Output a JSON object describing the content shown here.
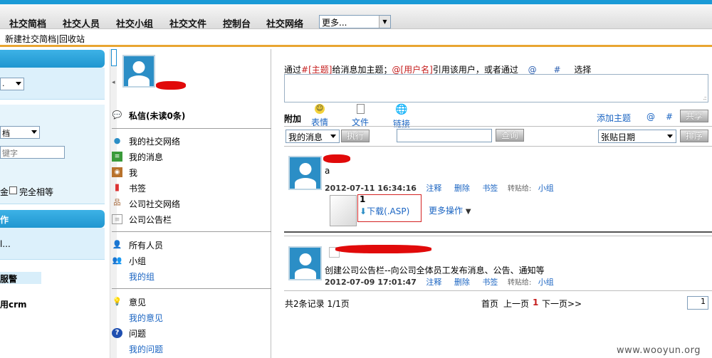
{
  "nav": {
    "items": [
      "社交简档",
      "社交人员",
      "社交小组",
      "社交文件",
      "控制台",
      "社交网络"
    ],
    "more_select": "更多..."
  },
  "subbar": {
    "text": "新建社交简档|回收站"
  },
  "left": {
    "sel1": ".",
    "sel2": "档",
    "keyword_placeholder": "键字",
    "checkbox1_label": "金",
    "checkbox2_label": "完全相等",
    "head2": "作",
    "panel_text": "l...",
    "alarm_label": "服警",
    "crm_text": "用crm"
  },
  "middle": {
    "private_msg": "私信(未读0条)",
    "items_a": [
      {
        "icon": "speech-bubble-icon",
        "label": "我的社交网络"
      },
      {
        "icon": "message-icon",
        "label": "我的消息"
      },
      {
        "icon": "contact-card-icon",
        "label": "我"
      },
      {
        "icon": "bookmark-icon",
        "label": "书签"
      },
      {
        "icon": "org-chart-icon",
        "label": "公司社交网络"
      },
      {
        "icon": "notice-board-icon",
        "label": "公司公告栏"
      }
    ],
    "all_people": "所有人员",
    "groups": "小组",
    "my_groups": "我的组",
    "opinion": "意见",
    "my_opinion": "我的意见",
    "question": "问题",
    "my_question": "我的问题"
  },
  "composer": {
    "hint_prefix": "通过",
    "hint_topic": "#[主题]",
    "hint_mid": "给消息加主题；",
    "hint_user": "@[用户名]",
    "hint_suffix": "引用该用户，或者通过",
    "hint_at": "@",
    "hint_hash": "#",
    "hint_end": "选择",
    "attach_label": "附加",
    "tool_emoji": "表情",
    "tool_file": "文件",
    "tool_link": "链接",
    "add_topic": "添加主题",
    "at": "@",
    "hash": "#",
    "share": "共享"
  },
  "filter": {
    "msg_select": "我的消息",
    "execute": "执行",
    "search_value": "",
    "query": "查询",
    "sort_select": "张贴日期",
    "sort": "排序"
  },
  "posts": [
    {
      "text": "a",
      "date": "2012-07-11 16:34:16",
      "comment": "注释",
      "delete": "删除",
      "bookmark": "书签",
      "forward_label": "转贴给:",
      "forward_target": "小组",
      "attach_count": "1",
      "download": "下载(.ASP)",
      "more_ops": "更多操作"
    },
    {
      "text": "创建公司公告栏--向公司全体员工发布消息、公告、通知等",
      "date": "2012-07-09 17:01:47",
      "comment": "注释",
      "delete": "删除",
      "bookmark": "书签",
      "forward_label": "转贴给:",
      "forward_target": "小组"
    }
  ],
  "pager": {
    "summary": "共2条记录 1/1页",
    "first": "首页",
    "prev": "上一页",
    "current": "1",
    "next": "下一页>>",
    "page_input": "1"
  },
  "watermark": "www.wooyun.org"
}
